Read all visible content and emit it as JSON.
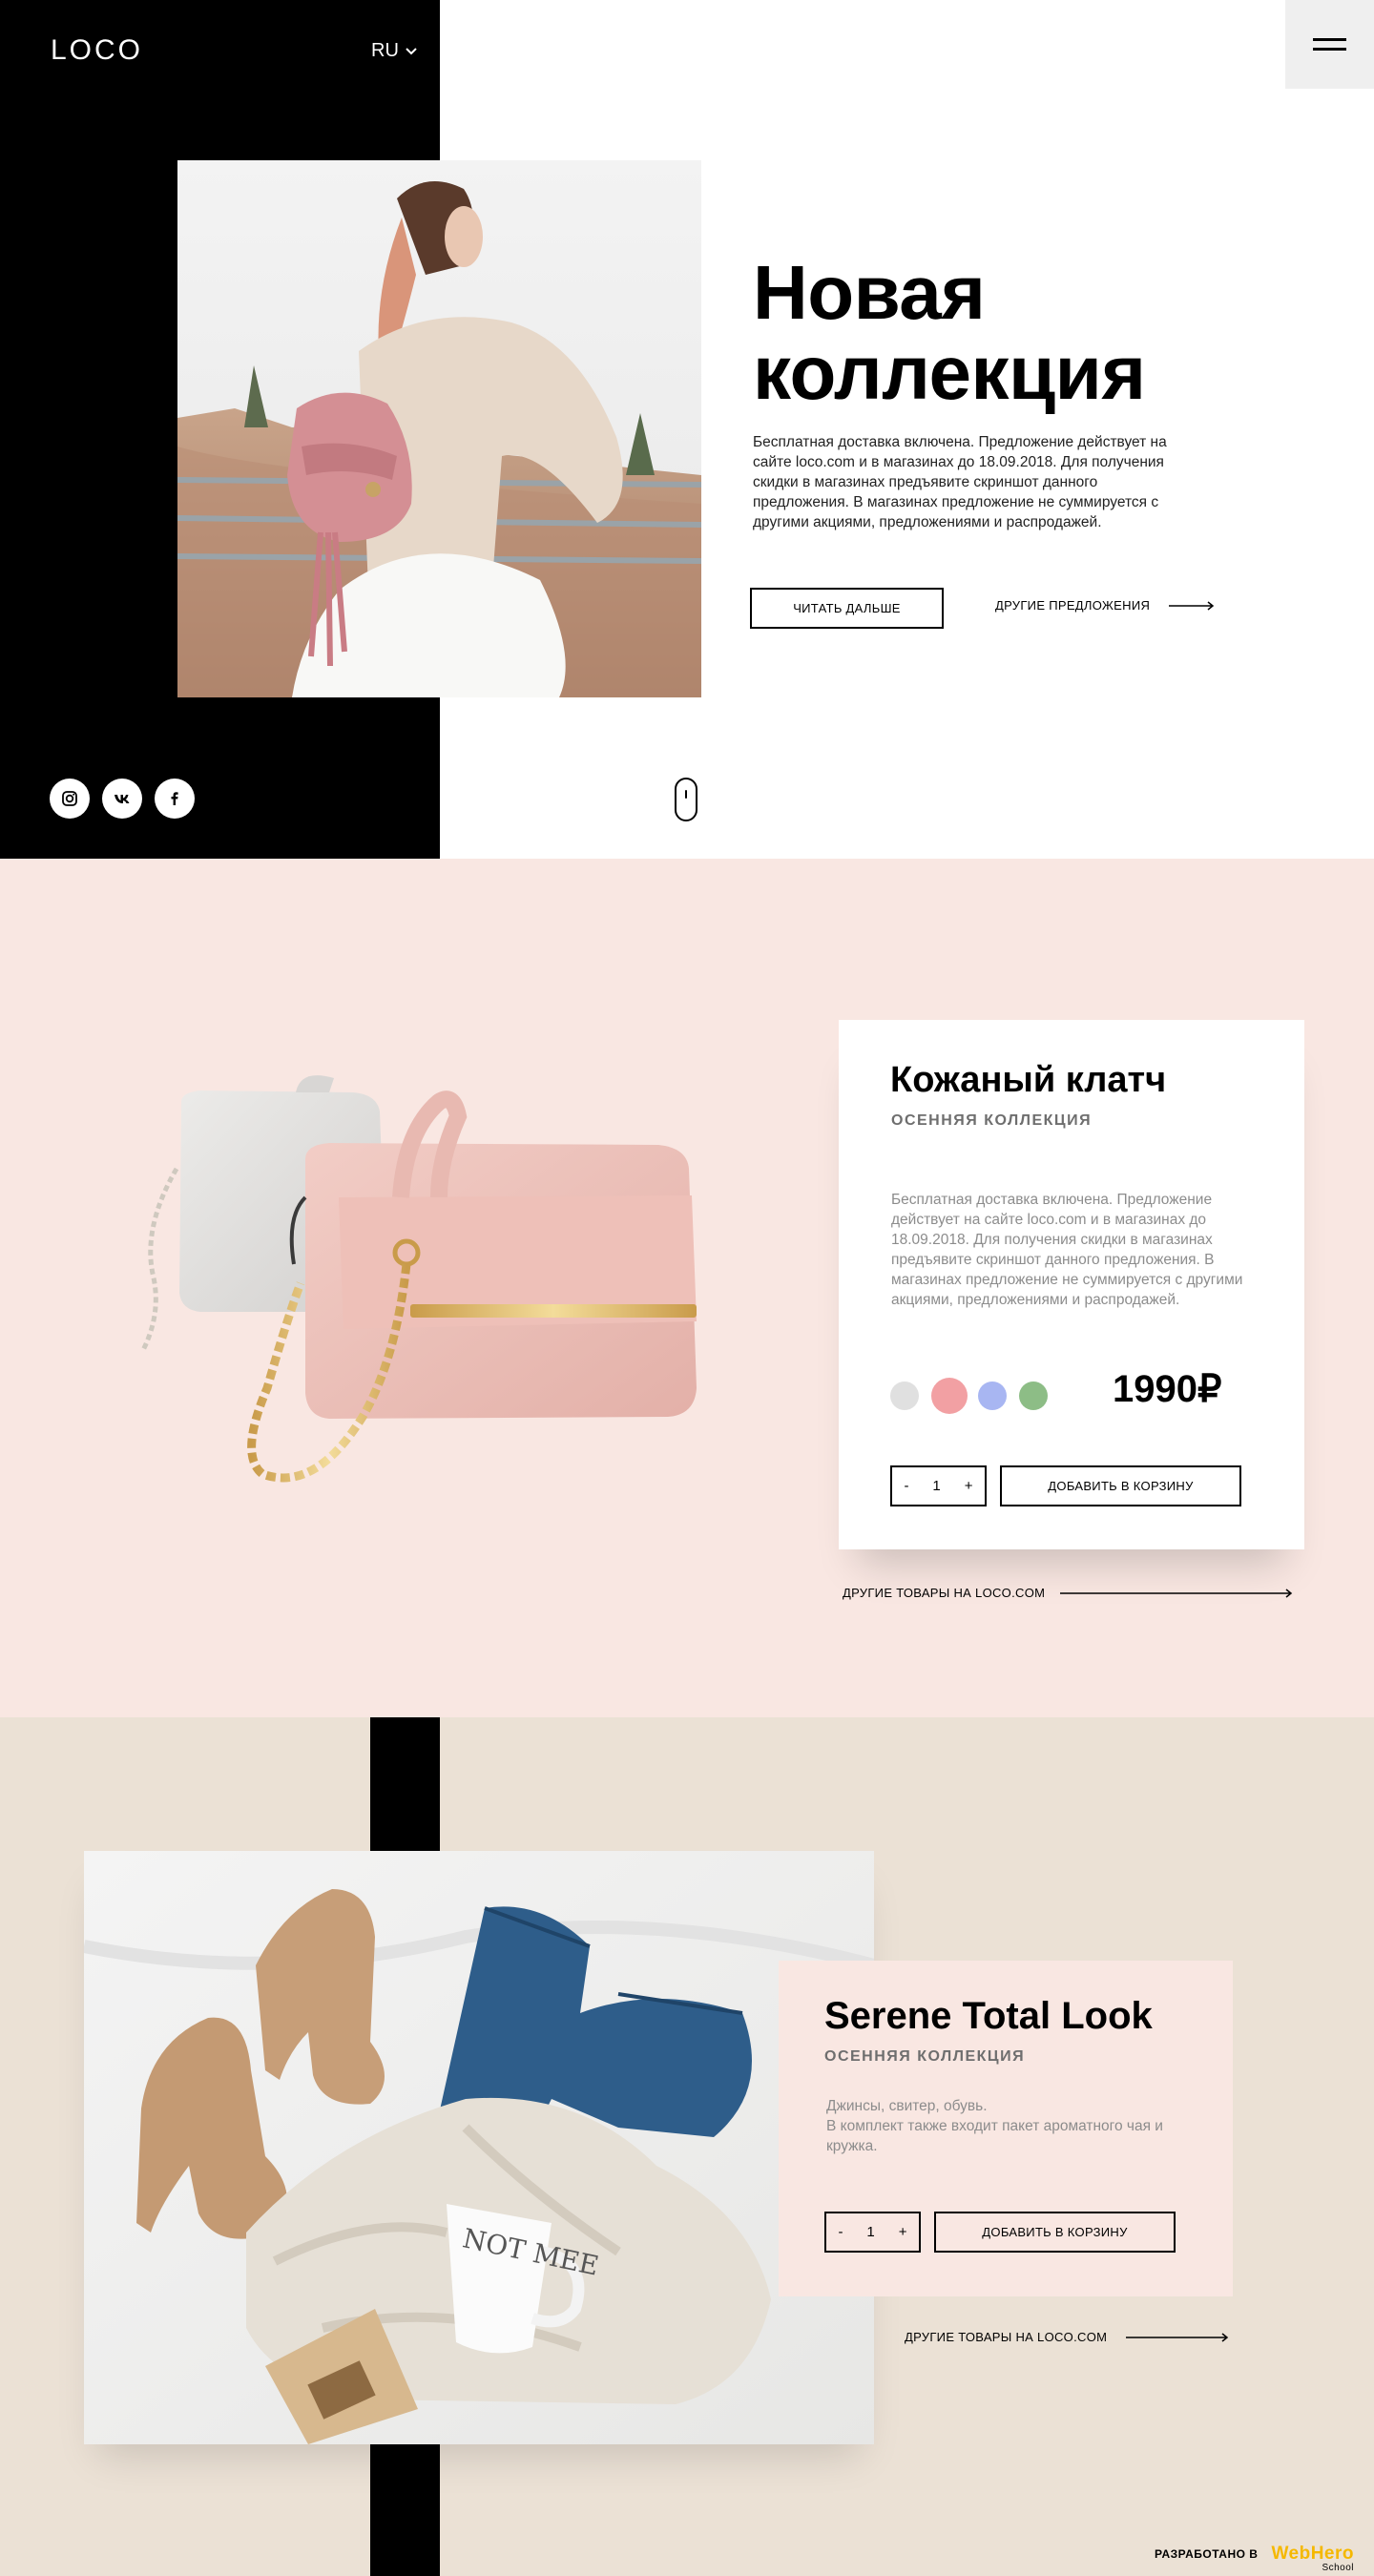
{
  "header": {
    "logo": "LOCO",
    "language": "RU"
  },
  "hero": {
    "title_line1": "Новая",
    "title_line2": "коллекция",
    "description": "Бесплатная доставка включена. Предложение действует на сайте loco.com и в магазинах до 18.09.2018. Для получения скидки в магазинах предъявите скриншот данного предложения. В магазинах предложение не суммируется с другими акциями, предложениями и распродажей.",
    "read_more": "ЧИТАТЬ ДАЛЬШЕ",
    "other_offers": "ДРУГИЕ ПРЕДЛОЖЕНИЯ"
  },
  "product1": {
    "title": "Кожаный клатч",
    "subtitle": "ОСЕННЯЯ КОЛЛЕКЦИЯ",
    "description": "Бесплатная доставка включена. Предложение действует на сайте loco.com и в магазинах до 18.09.2018. Для получения скидки в магазинах предъявите скриншот данного предложения. В магазинах предложение не суммируется с другими акциями, предложениями и распродажей.",
    "colors": [
      "#e0e0e0",
      "#f2a0a3",
      "#a8b6f2",
      "#8dbd86"
    ],
    "selected_color": 1,
    "price": "1990₽",
    "qty_minus": "-",
    "qty_value": "1",
    "qty_plus": "+",
    "add_to_cart": "ДОБАВИТЬ В КОРЗИНУ",
    "more_products": "ДРУГИЕ ТОВАРЫ НА LOCO.COM"
  },
  "product2": {
    "title": "Serene Total Look",
    "subtitle": "ОСЕННЯЯ КОЛЛЕКЦИЯ",
    "description": "Джинсы, свитер, обувь.\nВ комплект также входит пакет ароматного чая и кружка.",
    "mug_text": "NOT MEE",
    "qty_minus": "-",
    "qty_value": "1",
    "qty_plus": "+",
    "add_to_cart": "ДОБАВИТЬ В КОРЗИНУ",
    "more_products": "ДРУГИЕ ТОВАРЫ НА LOCO.COM"
  },
  "footer": {
    "credit_label": "РАЗРАБОТАНО В",
    "credit_brand": "WebHero",
    "credit_brand_sub": "School"
  },
  "icons": [
    "instagram-icon",
    "vk-icon",
    "facebook-icon",
    "chevron-down-icon",
    "hamburger-icon",
    "arrow-right-icon",
    "mouse-scroll-icon"
  ]
}
